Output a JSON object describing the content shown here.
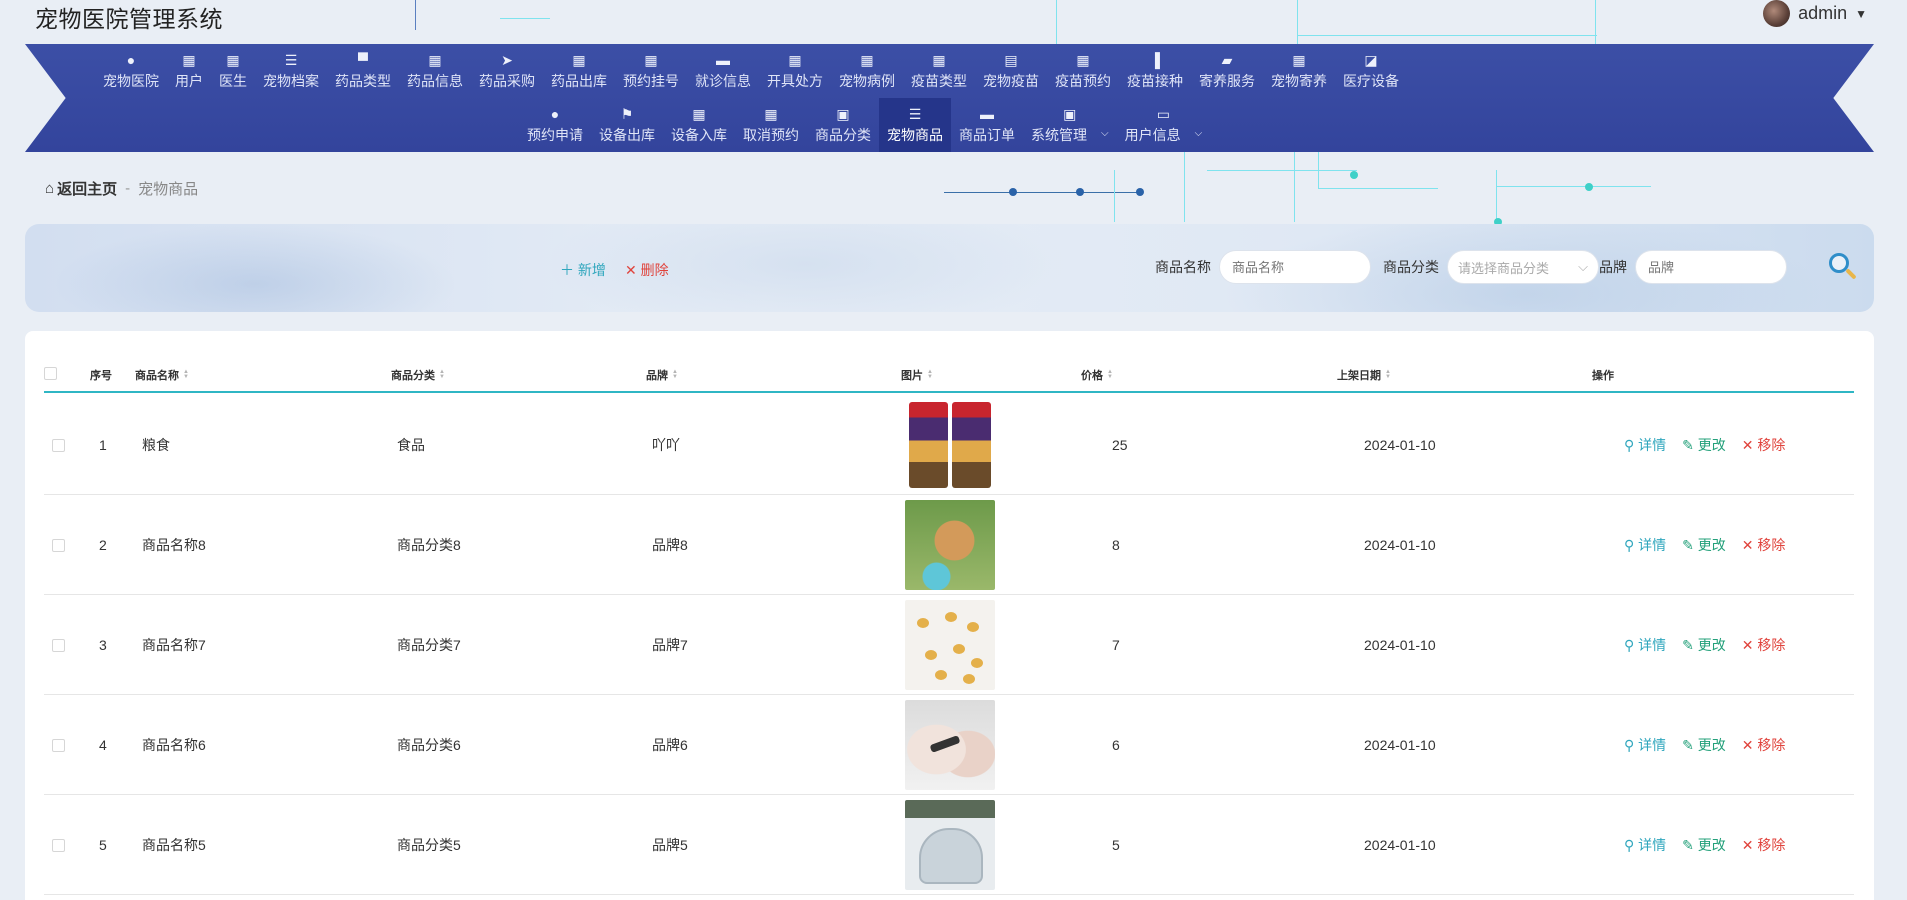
{
  "header": {
    "title": "宠物医院管理系统",
    "user": "admin"
  },
  "nav": {
    "row1": [
      {
        "label": "宠物医院",
        "icon": "user-icon"
      },
      {
        "label": "用户",
        "icon": "grid-icon"
      },
      {
        "label": "医生",
        "icon": "grid-icon"
      },
      {
        "label": "宠物档案",
        "icon": "list-icon"
      },
      {
        "label": "药品类型",
        "icon": "chair-icon"
      },
      {
        "label": "药品信息",
        "icon": "grid-icon"
      },
      {
        "label": "药品采购",
        "icon": "send-icon"
      },
      {
        "label": "药品出库",
        "icon": "grid-icon"
      },
      {
        "label": "预约挂号",
        "icon": "grid-icon"
      },
      {
        "label": "就诊信息",
        "icon": "monitor-icon"
      },
      {
        "label": "开具处方",
        "icon": "grid-icon"
      },
      {
        "label": "宠物病例",
        "icon": "grid-icon"
      },
      {
        "label": "疫苗类型",
        "icon": "grid-icon"
      },
      {
        "label": "宠物疫苗",
        "icon": "clipboard-icon"
      },
      {
        "label": "疫苗预约",
        "icon": "grid-icon"
      },
      {
        "label": "疫苗接种",
        "icon": "bar-chart-icon"
      },
      {
        "label": "寄养服务",
        "icon": "wallet-icon"
      },
      {
        "label": "宠物寄养",
        "icon": "grid-icon"
      },
      {
        "label": "医疗设备",
        "icon": "line-chart-icon"
      }
    ],
    "row2": [
      {
        "label": "预约申请",
        "icon": "bulb-icon"
      },
      {
        "label": "设备出库",
        "icon": "flag-icon"
      },
      {
        "label": "设备入库",
        "icon": "apps-icon"
      },
      {
        "label": "取消预约",
        "icon": "grid-icon"
      },
      {
        "label": "商品分类",
        "icon": "clipboard-x-icon"
      },
      {
        "label": "宠物商品",
        "icon": "sliders-icon",
        "active": true
      },
      {
        "label": "商品订单",
        "icon": "message-icon"
      },
      {
        "label": "系统管理",
        "icon": "clipboard-check-icon",
        "dropdown": true
      },
      {
        "label": "用户信息",
        "icon": "card-icon",
        "dropdown": true
      }
    ]
  },
  "breadcrumb": {
    "home": "返回主页",
    "separator": "-",
    "current": "宠物商品"
  },
  "toolbar": {
    "add": "新增",
    "delete": "删除"
  },
  "search": {
    "name_label": "商品名称",
    "name_placeholder": "商品名称",
    "category_label": "商品分类",
    "category_placeholder": "请选择商品分类",
    "brand_label": "品牌",
    "brand_placeholder": "品牌"
  },
  "table": {
    "columns": [
      "序号",
      "商品名称",
      "商品分类",
      "品牌",
      "图片",
      "价格",
      "上架日期",
      "操作"
    ],
    "actions": {
      "detail": "详情",
      "edit": "更改",
      "remove": "移除"
    },
    "rows": [
      {
        "index": "1",
        "name": "粮食",
        "category": "食品",
        "brand": "吖吖",
        "image": "pet-food-bags",
        "price": "25",
        "date": "2024-01-10"
      },
      {
        "index": "2",
        "name": "商品名称8",
        "category": "商品分类8",
        "brand": "品牌8",
        "image": "golden-retriever",
        "price": "8",
        "date": "2024-01-10"
      },
      {
        "index": "3",
        "name": "商品名称7",
        "category": "商品分类7",
        "brand": "品牌7",
        "image": "pet-illustrations",
        "price": "7",
        "date": "2024-01-10"
      },
      {
        "index": "4",
        "name": "商品名称6",
        "category": "商品分类6",
        "brand": "品牌6",
        "image": "nail-clipper",
        "price": "6",
        "date": "2024-01-10"
      },
      {
        "index": "5",
        "name": "商品名称5",
        "category": "商品分类5",
        "brand": "品牌5",
        "image": "litter-box",
        "price": "5",
        "date": "2024-01-10"
      }
    ]
  }
}
